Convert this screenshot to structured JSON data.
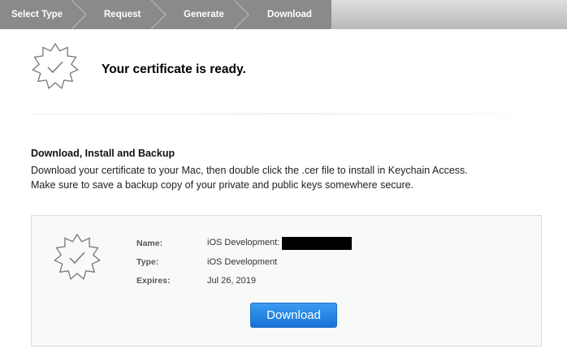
{
  "steps": [
    "Select Type",
    "Request",
    "Generate",
    "Download"
  ],
  "header": {
    "title": "Your certificate is ready."
  },
  "section": {
    "heading": "Download, Install and Backup",
    "line1": "Download your certificate to your Mac, then double click the .cer file to install in Keychain Access.",
    "line2": "Make sure to save a backup copy of your private and public keys somewhere secure."
  },
  "certificate": {
    "name_label": "Name:",
    "name_value": "iOS Development:",
    "type_label": "Type:",
    "type_value": "iOS Development",
    "expires_label": "Expires:",
    "expires_value": "Jul 26, 2019",
    "download_label": "Download"
  },
  "colors": {
    "accent": "#1f83e2",
    "step_bar": "#8a8a8a"
  }
}
